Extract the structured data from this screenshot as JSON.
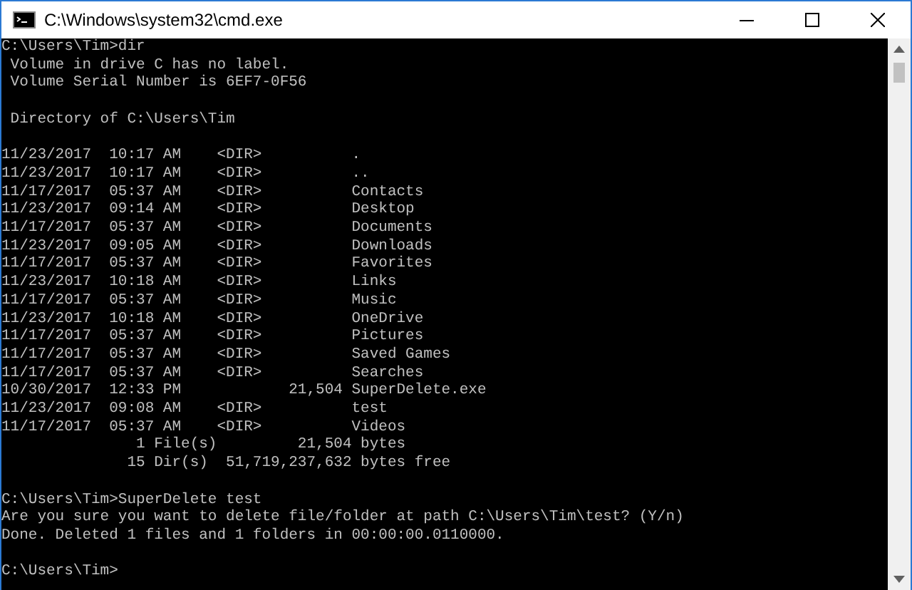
{
  "window": {
    "title": "C:\\Windows\\system32\\cmd.exe"
  },
  "console_blocks": [
    [
      "C:\\Users\\Tim>dir",
      " Volume in drive C has no label.",
      " Volume Serial Number is 6EF7-0F56"
    ],
    [
      " Directory of C:\\Users\\Tim"
    ],
    [
      "11/23/2017  10:17 AM    <DIR>          .",
      "11/23/2017  10:17 AM    <DIR>          ..",
      "11/17/2017  05:37 AM    <DIR>          Contacts",
      "11/23/2017  09:14 AM    <DIR>          Desktop",
      "11/17/2017  05:37 AM    <DIR>          Documents",
      "11/23/2017  09:05 AM    <DIR>          Downloads",
      "11/17/2017  05:37 AM    <DIR>          Favorites",
      "11/23/2017  10:18 AM    <DIR>          Links",
      "11/17/2017  05:37 AM    <DIR>          Music",
      "11/23/2017  10:18 AM    <DIR>          OneDrive",
      "11/17/2017  05:37 AM    <DIR>          Pictures",
      "11/17/2017  05:37 AM    <DIR>          Saved Games",
      "11/17/2017  05:37 AM    <DIR>          Searches",
      "10/30/2017  12:33 PM            21,504 SuperDelete.exe",
      "11/23/2017  09:08 AM    <DIR>          test",
      "11/17/2017  05:37 AM    <DIR>          Videos",
      "               1 File(s)         21,504 bytes",
      "              15 Dir(s)  51,719,237,632 bytes free"
    ],
    [
      "C:\\Users\\Tim>SuperDelete test",
      "Are you sure you want to delete file/folder at path C:\\Users\\Tim\\test? (Y/n)",
      "Done. Deleted 1 files and 1 folders in 00:00:00.0110000."
    ],
    [
      "C:\\Users\\Tim>"
    ]
  ]
}
